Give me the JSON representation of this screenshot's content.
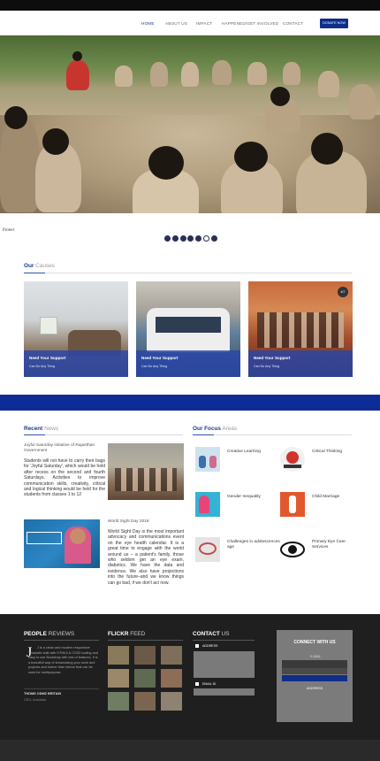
{
  "nav": {
    "items": [
      "HOME",
      "ABOUT US",
      "IMPACT",
      "HAPPENED/GET INVOLVED",
      "CONTACT"
    ],
    "donate": "DONATE NOW"
  },
  "hero": {
    "caption": "Protect"
  },
  "slider": {
    "count": 7,
    "active_index": 5
  },
  "causes": {
    "title_accent": "Our",
    "title_rest": " Causes",
    "cards": [
      {
        "title": "Need Your Support",
        "subtitle": "Can Do Any Thing"
      },
      {
        "title": "Need Your Support",
        "subtitle": "Can Do Any Thing"
      },
      {
        "title": "Need Your Support",
        "subtitle": "Can Do Any Thing",
        "badge": "4/7"
      }
    ]
  },
  "news": {
    "title_accent": "Recent",
    "title_rest": " News",
    "item1_title": "Joyful Saturday initiative of Rajasthan Government",
    "item1_body": "Students will not have to carry their bags for 'Joyful Saturday', which would be held after recess on the second and fourth Saturdays. Activities to improve communication skills, creativity, critical and logical thinking would be held for the students from classes 1 to 12",
    "item2_title": "World Sight Day 2018",
    "item2_body": "World Sight Day is the most important advocacy and communications event on the eye health calendar. It is a great time to engage with the world around us – a patient's family, those who seldom get an eye exam, diabetics. We have the data and evidence. We also have projections into the future–and we know things can go bad, if we don't act now."
  },
  "focus": {
    "title_accent": "Our Focus",
    "title_rest": " Areas",
    "items": [
      {
        "label": "Creative Learning",
        "icon": "creative-learning-icon"
      },
      {
        "label": "Critical Thinking",
        "icon": "critical-thinking-icon"
      },
      {
        "label": "Gender Inequality",
        "icon": "gender-inequality-icon"
      },
      {
        "label": "Child Marriage",
        "icon": "child-marriage-icon"
      },
      {
        "label": "Challenges in adolescences age",
        "icon": "adolescence-icon"
      },
      {
        "label": "Primary Eye Care Services",
        "icon": "eye-care-icon"
      }
    ]
  },
  "footer": {
    "reviews_accent": "PEOPLE",
    "reviews_rest": " REVIEWS",
    "quote": "J is a clean and modern responsive Template built with HTML5 & CSS3 coding and easy to use Bootstrap with lots of features. It is a beautiful way of showcasing your work and projects and further than before that can be used for multipurpose.",
    "author": "THOMS ODMZ BRITAIN",
    "author_location": "CEO, Australia",
    "flickr_accent": "FLICKR",
    "flickr_rest": " FEED",
    "contact_accent": "CONTACT",
    "contact_rest": " US",
    "address_label": "ADDRESS",
    "email_label": "EMAIL ID",
    "connect_title": "CONNECT WITH US",
    "email_placeholder": "E-MAIL",
    "address_button": "ADDRESS"
  },
  "colors": {
    "brand": "#0f2d8a",
    "accent": "#2a55b0",
    "footer": "#1f1f1f"
  }
}
